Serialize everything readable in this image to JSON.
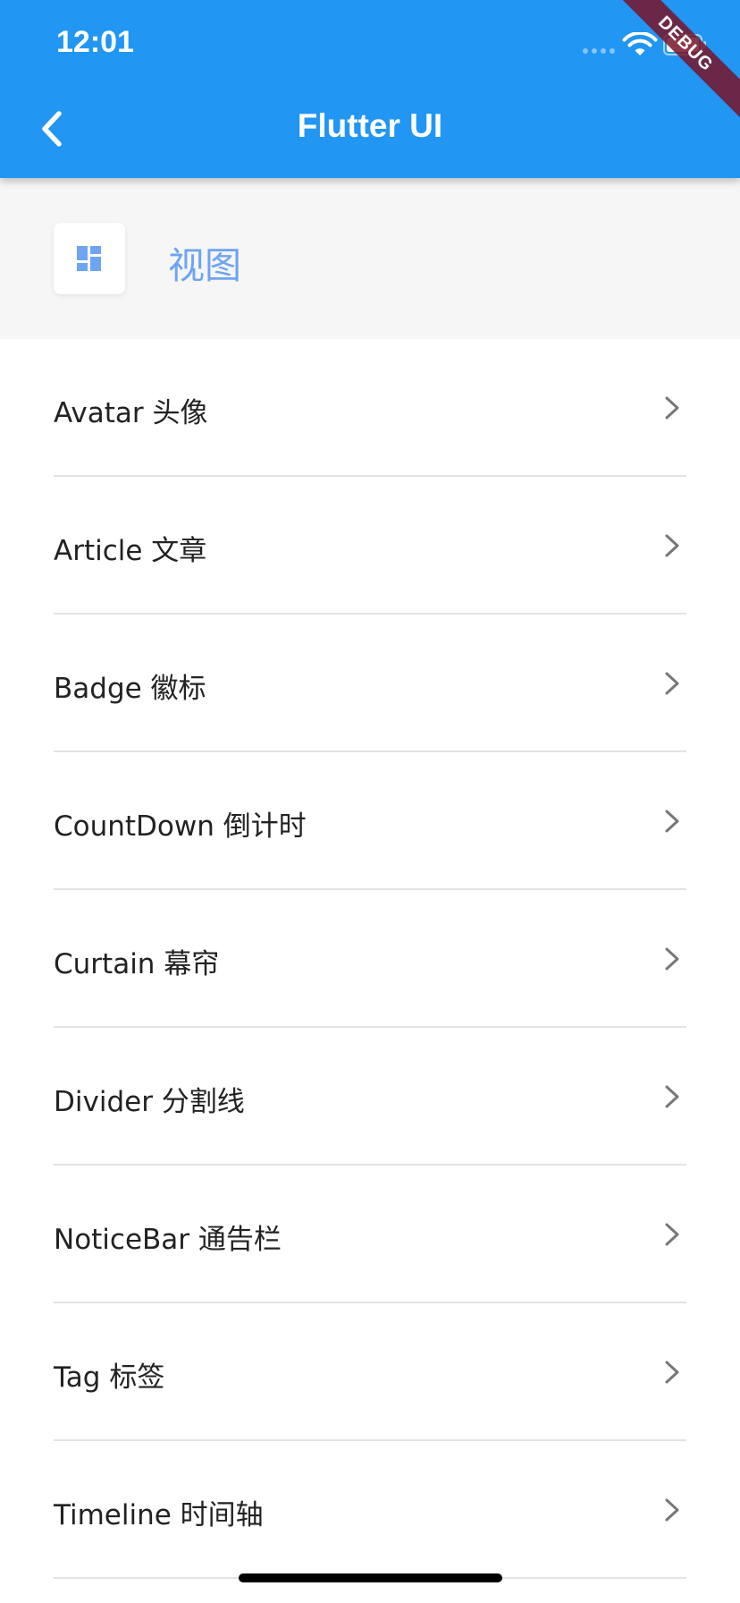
{
  "status_bar": {
    "time": "12:01"
  },
  "appbar": {
    "title": "Flutter UI",
    "color": "#2196f3",
    "debug_banner": "DEBUG"
  },
  "section": {
    "title": "视图",
    "icon": "dashboard-icon",
    "title_color": "#6ea4f2"
  },
  "list": {
    "items": [
      {
        "label": "Avatar 头像"
      },
      {
        "label": "Article 文章"
      },
      {
        "label": "Badge 徽标"
      },
      {
        "label": "CountDown 倒计时"
      },
      {
        "label": "Curtain 幕帘"
      },
      {
        "label": "Divider 分割线"
      },
      {
        "label": "NoticeBar 通告栏"
      },
      {
        "label": "Tag 标签"
      },
      {
        "label": "Timeline 时间轴"
      }
    ]
  }
}
